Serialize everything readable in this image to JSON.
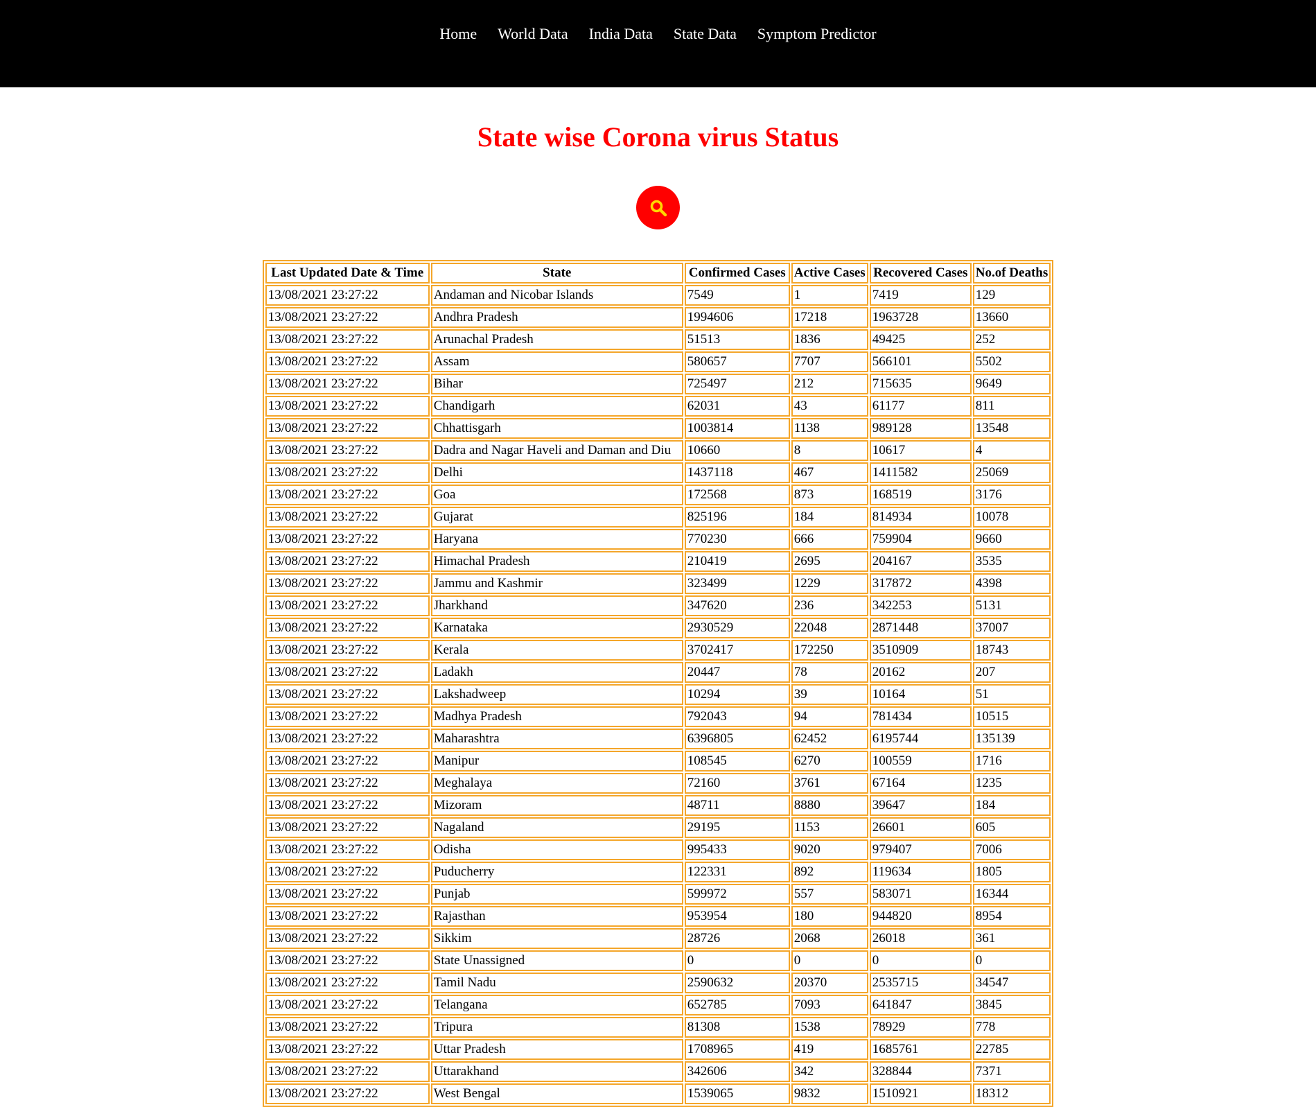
{
  "nav": {
    "items": [
      "Home",
      "World Data",
      "India Data",
      "State Data",
      "Symptom Predictor"
    ]
  },
  "page": {
    "title": "State wise Corona virus Status"
  },
  "search": {
    "icon": "search-icon",
    "button_color": "#ff0000",
    "icon_color": "#ffd700"
  },
  "colors": {
    "navbar": "#000000",
    "title": "#ff0000",
    "table_border": "#f4a62a"
  },
  "table": {
    "headers": [
      "Last Updated Date & Time",
      "State",
      "Confirmed Cases",
      "Active Cases",
      "Recovered Cases",
      "No.of Deaths"
    ],
    "rows": [
      [
        "13/08/2021 23:27:22",
        "Andaman and Nicobar Islands",
        "7549",
        "1",
        "7419",
        "129"
      ],
      [
        "13/08/2021 23:27:22",
        "Andhra Pradesh",
        "1994606",
        "17218",
        "1963728",
        "13660"
      ],
      [
        "13/08/2021 23:27:22",
        "Arunachal Pradesh",
        "51513",
        "1836",
        "49425",
        "252"
      ],
      [
        "13/08/2021 23:27:22",
        "Assam",
        "580657",
        "7707",
        "566101",
        "5502"
      ],
      [
        "13/08/2021 23:27:22",
        "Bihar",
        "725497",
        "212",
        "715635",
        "9649"
      ],
      [
        "13/08/2021 23:27:22",
        "Chandigarh",
        "62031",
        "43",
        "61177",
        "811"
      ],
      [
        "13/08/2021 23:27:22",
        "Chhattisgarh",
        "1003814",
        "1138",
        "989128",
        "13548"
      ],
      [
        "13/08/2021 23:27:22",
        "Dadra and Nagar Haveli and Daman and Diu",
        "10660",
        "8",
        "10617",
        "4"
      ],
      [
        "13/08/2021 23:27:22",
        "Delhi",
        "1437118",
        "467",
        "1411582",
        "25069"
      ],
      [
        "13/08/2021 23:27:22",
        "Goa",
        "172568",
        "873",
        "168519",
        "3176"
      ],
      [
        "13/08/2021 23:27:22",
        "Gujarat",
        "825196",
        "184",
        "814934",
        "10078"
      ],
      [
        "13/08/2021 23:27:22",
        "Haryana",
        "770230",
        "666",
        "759904",
        "9660"
      ],
      [
        "13/08/2021 23:27:22",
        "Himachal Pradesh",
        "210419",
        "2695",
        "204167",
        "3535"
      ],
      [
        "13/08/2021 23:27:22",
        "Jammu and Kashmir",
        "323499",
        "1229",
        "317872",
        "4398"
      ],
      [
        "13/08/2021 23:27:22",
        "Jharkhand",
        "347620",
        "236",
        "342253",
        "5131"
      ],
      [
        "13/08/2021 23:27:22",
        "Karnataka",
        "2930529",
        "22048",
        "2871448",
        "37007"
      ],
      [
        "13/08/2021 23:27:22",
        "Kerala",
        "3702417",
        "172250",
        "3510909",
        "18743"
      ],
      [
        "13/08/2021 23:27:22",
        "Ladakh",
        "20447",
        "78",
        "20162",
        "207"
      ],
      [
        "13/08/2021 23:27:22",
        "Lakshadweep",
        "10294",
        "39",
        "10164",
        "51"
      ],
      [
        "13/08/2021 23:27:22",
        "Madhya Pradesh",
        "792043",
        "94",
        "781434",
        "10515"
      ],
      [
        "13/08/2021 23:27:22",
        "Maharashtra",
        "6396805",
        "62452",
        "6195744",
        "135139"
      ],
      [
        "13/08/2021 23:27:22",
        "Manipur",
        "108545",
        "6270",
        "100559",
        "1716"
      ],
      [
        "13/08/2021 23:27:22",
        "Meghalaya",
        "72160",
        "3761",
        "67164",
        "1235"
      ],
      [
        "13/08/2021 23:27:22",
        "Mizoram",
        "48711",
        "8880",
        "39647",
        "184"
      ],
      [
        "13/08/2021 23:27:22",
        "Nagaland",
        "29195",
        "1153",
        "26601",
        "605"
      ],
      [
        "13/08/2021 23:27:22",
        "Odisha",
        "995433",
        "9020",
        "979407",
        "7006"
      ],
      [
        "13/08/2021 23:27:22",
        "Puducherry",
        "122331",
        "892",
        "119634",
        "1805"
      ],
      [
        "13/08/2021 23:27:22",
        "Punjab",
        "599972",
        "557",
        "583071",
        "16344"
      ],
      [
        "13/08/2021 23:27:22",
        "Rajasthan",
        "953954",
        "180",
        "944820",
        "8954"
      ],
      [
        "13/08/2021 23:27:22",
        "Sikkim",
        "28726",
        "2068",
        "26018",
        "361"
      ],
      [
        "13/08/2021 23:27:22",
        "State Unassigned",
        "0",
        "0",
        "0",
        "0"
      ],
      [
        "13/08/2021 23:27:22",
        "Tamil Nadu",
        "2590632",
        "20370",
        "2535715",
        "34547"
      ],
      [
        "13/08/2021 23:27:22",
        "Telangana",
        "652785",
        "7093",
        "641847",
        "3845"
      ],
      [
        "13/08/2021 23:27:22",
        "Tripura",
        "81308",
        "1538",
        "78929",
        "778"
      ],
      [
        "13/08/2021 23:27:22",
        "Uttar Pradesh",
        "1708965",
        "419",
        "1685761",
        "22785"
      ],
      [
        "13/08/2021 23:27:22",
        "Uttarakhand",
        "342606",
        "342",
        "328844",
        "7371"
      ],
      [
        "13/08/2021 23:27:22",
        "West Bengal",
        "1539065",
        "9832",
        "1510921",
        "18312"
      ]
    ]
  }
}
